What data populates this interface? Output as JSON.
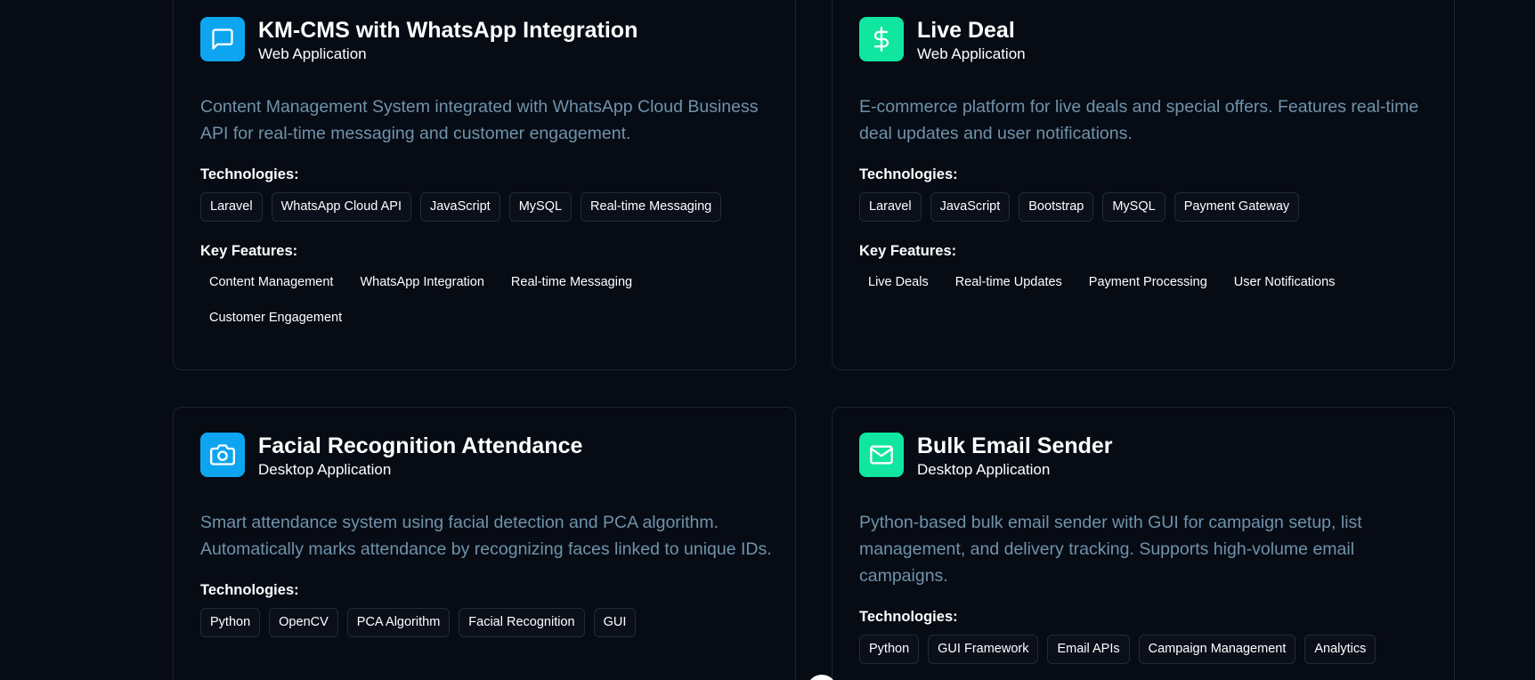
{
  "colors": {
    "background": "#070b14",
    "icon_blue": "#0ea5f0",
    "icon_green": "#10e6a0",
    "description": "#6f93ab"
  },
  "projects": [
    {
      "icon": "message-square-icon",
      "title": "KM-CMS with WhatsApp Integration",
      "type": "Web Application",
      "description": "Content Management System integrated with WhatsApp Cloud Business API for real-time messaging and customer engagement.",
      "tech_label": "Technologies:",
      "technologies": [
        "Laravel",
        "WhatsApp Cloud API",
        "JavaScript",
        "MySQL",
        "Real-time Messaging"
      ],
      "features_label": "Key Features:",
      "features": [
        "Content Management",
        "WhatsApp Integration",
        "Real-time Messaging",
        "Customer Engagement"
      ]
    },
    {
      "icon": "dollar-sign-icon",
      "title": "Live Deal",
      "type": "Web Application",
      "description": "E-commerce platform for live deals and special offers. Features real-time deal updates and user notifications.",
      "tech_label": "Technologies:",
      "technologies": [
        "Laravel",
        "JavaScript",
        "Bootstrap",
        "MySQL",
        "Payment Gateway"
      ],
      "features_label": "Key Features:",
      "features": [
        "Live Deals",
        "Real-time Updates",
        "Payment Processing",
        "User Notifications"
      ]
    },
    {
      "icon": "camera-icon",
      "title": "Facial Recognition Attendance",
      "type": "Desktop Application",
      "description": "Smart attendance system using facial detection and PCA algorithm. Automatically marks attendance by recognizing faces linked to unique IDs.",
      "tech_label": "Technologies:",
      "technologies": [
        "Python",
        "OpenCV",
        "PCA Algorithm",
        "Facial Recognition",
        "GUI"
      ]
    },
    {
      "icon": "mail-icon",
      "title": "Bulk Email Sender",
      "type": "Desktop Application",
      "description": "Python-based bulk email sender with GUI for campaign setup, list management, and delivery tracking. Supports high-volume email campaigns.",
      "tech_label": "Technologies:",
      "technologies": [
        "Python",
        "GUI Framework",
        "Email APIs",
        "Campaign Management",
        "Analytics"
      ]
    }
  ]
}
